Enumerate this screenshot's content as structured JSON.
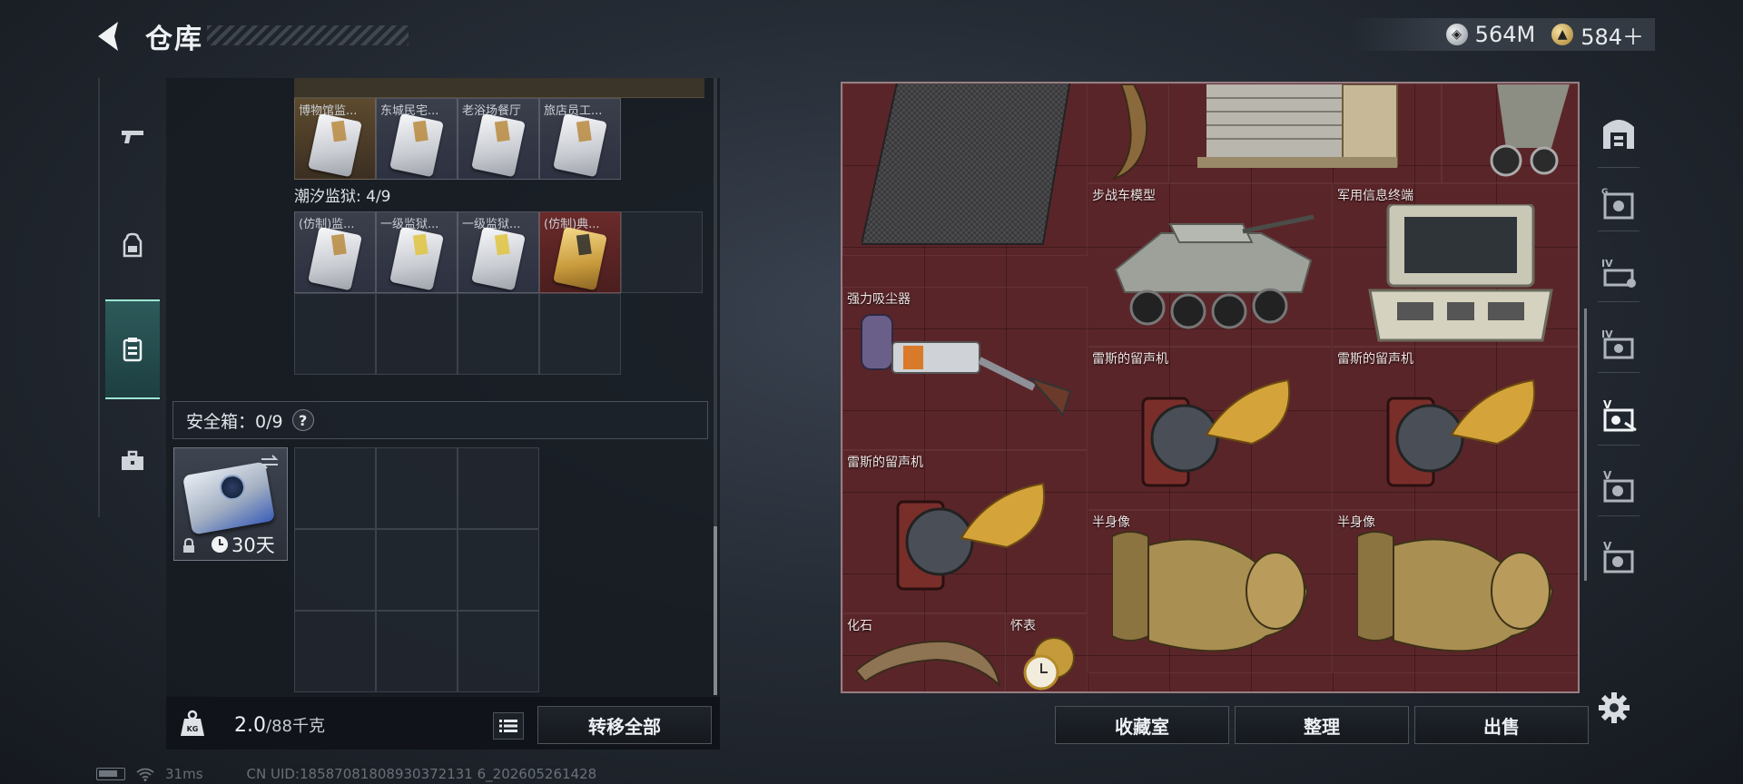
{
  "header": {
    "title": "仓库",
    "currencies": [
      {
        "icon": "silver-coin-icon",
        "value": "564M"
      },
      {
        "icon": "gold-coin-icon",
        "value": "584＋"
      }
    ]
  },
  "left_rail": {
    "items": [
      {
        "icon": "pistol-icon"
      },
      {
        "icon": "backpack-icon"
      },
      {
        "icon": "container-icon"
      },
      {
        "icon": "toolbox-icon"
      }
    ]
  },
  "inventory": {
    "row1": [
      {
        "name": "博物馆监..."
      },
      {
        "name": "东城民宅..."
      },
      {
        "name": "老浴场餐厅"
      },
      {
        "name": "旅店员工..."
      }
    ],
    "prison_label": "潮汐监狱: 4/9",
    "row2": [
      {
        "name": "(仿制)监..."
      },
      {
        "name": "一级监狱..."
      },
      {
        "name": "一级监狱..."
      },
      {
        "name": "(仿制)典..."
      }
    ],
    "safe_box_label": "安全箱：0/9",
    "help": "?",
    "safe_box_days": "30天",
    "weight_value": "2.0",
    "weight_capacity": "/88千克",
    "transfer_all": "转移全部"
  },
  "collection": {
    "items": [
      {
        "name": "步战车模型"
      },
      {
        "name": "军用信息终端"
      },
      {
        "name": "强力吸尘器"
      },
      {
        "name": "雷斯的留声机"
      },
      {
        "name": "雷斯的留声机"
      },
      {
        "name": "雷斯的留声机"
      },
      {
        "name": "半身像"
      },
      {
        "name": "半身像"
      },
      {
        "name": "化石"
      },
      {
        "name": "怀表"
      }
    ],
    "buttons": {
      "collection_room": "收藏室",
      "organize": "整理",
      "sell": "出售"
    }
  },
  "right_rail": {
    "items": [
      {
        "icon": "warehouse-icon"
      },
      {
        "icon": "safe-tier-g-icon"
      },
      {
        "icon": "safe-tier-iv-icon"
      },
      {
        "icon": "safe-tier-iv-b-icon"
      },
      {
        "icon": "safe-tier-v-icon"
      },
      {
        "icon": "safe-tier-v-b-icon"
      },
      {
        "icon": "safe-tier-v-c-icon"
      }
    ]
  },
  "status": {
    "ping": "31ms",
    "uid": "CN UID:18587081808930372131 6_202605261428"
  }
}
